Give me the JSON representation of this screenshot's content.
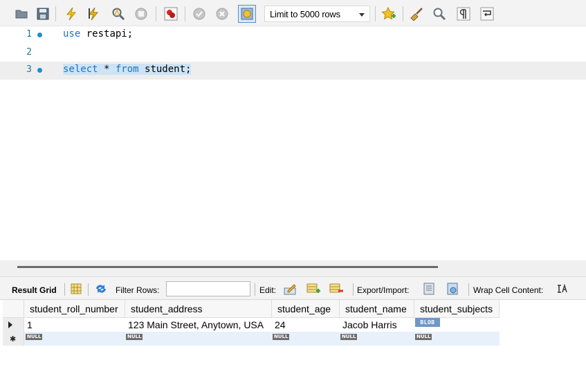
{
  "toolbar": {
    "limit_label": "Limit to 5000 rows",
    "icons": [
      "open-folder-icon",
      "save-icon",
      "execute-lightning-icon",
      "execute-cursor-icon",
      "explain-magnifier-icon",
      "stop-icon",
      "toggle-error-icon",
      "commit-check-icon",
      "rollback-x-icon",
      "autocommit-icon",
      "add-snippet-star-icon",
      "beautify-broom-icon",
      "find-magnifier-icon",
      "invisible-chars-pilcrow-icon",
      "wrap-lines-icon"
    ]
  },
  "editor": {
    "lines": [
      {
        "number": "1",
        "keyword": "use",
        "rest": " restapi;"
      },
      {
        "number": "2",
        "keyword": "",
        "rest": ""
      },
      {
        "number": "3",
        "keyword": "select",
        "rest": " * ",
        "keyword2": "from",
        "rest2": " student;"
      }
    ]
  },
  "result_toolbar": {
    "result_grid_label": "Result Grid",
    "filter_label": "Filter Rows:",
    "filter_value": "",
    "edit_label": "Edit:",
    "export_label": "Export/Import:",
    "wrap_label": "Wrap Cell Content:"
  },
  "grid": {
    "columns": [
      "student_roll_number",
      "student_address",
      "student_age",
      "student_name",
      "student_subjects"
    ],
    "rows": [
      [
        "1",
        "123 Main Street, Anytown, USA",
        "24",
        "Jacob Harris",
        "BLOB"
      ],
      [
        "NULL",
        "NULL",
        "NULL",
        "NULL",
        "NULL"
      ]
    ]
  },
  "colors": {
    "keyword": "#1e73c2",
    "line_number": "#1e7a94",
    "selection": "#cde3f6",
    "blob_badge": "#6f98c7",
    "null_badge": "#6d6d6d"
  }
}
